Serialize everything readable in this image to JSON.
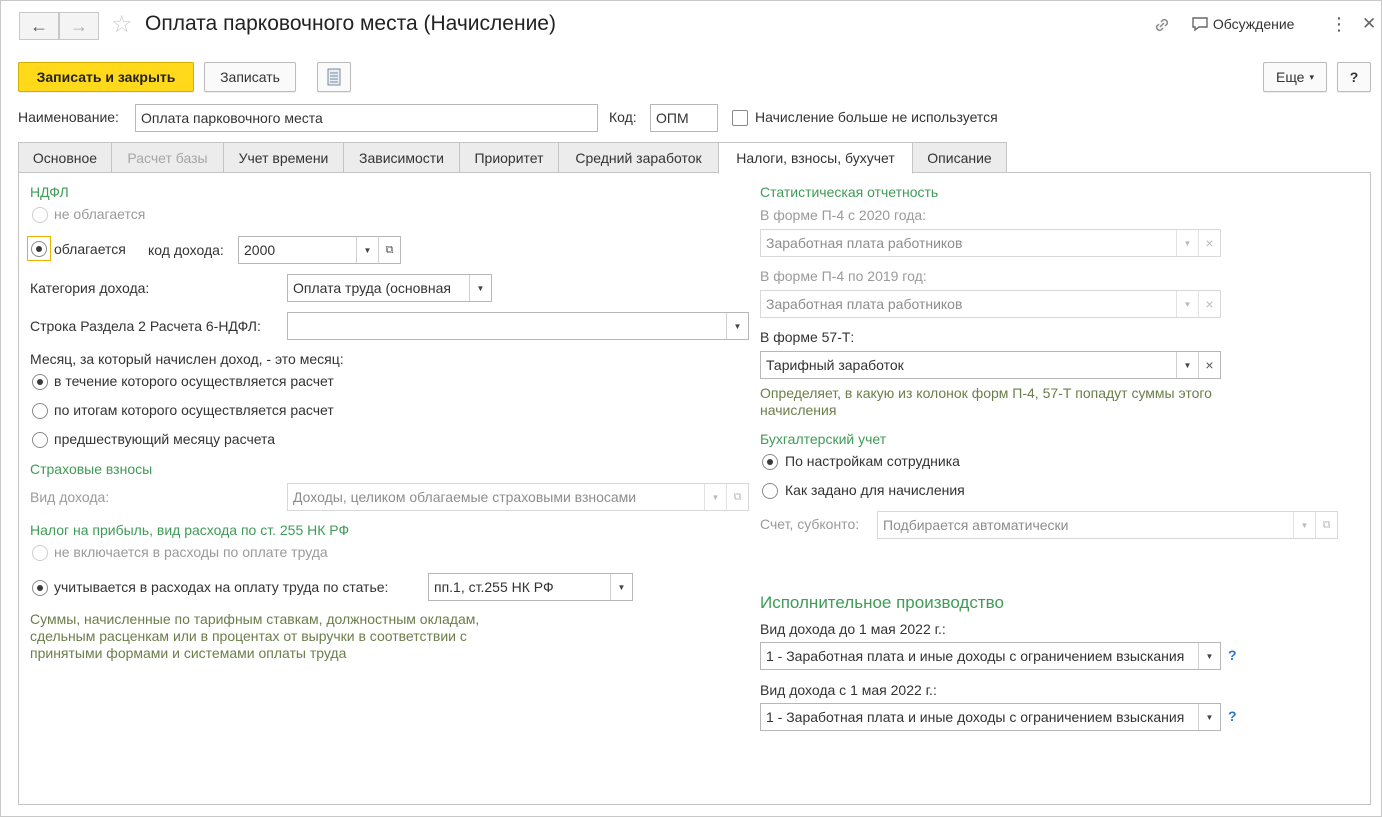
{
  "window": {
    "title": "Оплата парковочного места (Начисление)",
    "back_icon": "←",
    "forward_icon": "→",
    "star_icon": "☆",
    "link_icon": "🔗",
    "discussion_label": "Обсуждение",
    "more_icon": "⋮",
    "close_icon": "✕"
  },
  "toolbar": {
    "save_close": "Записать и закрыть",
    "save": "Записать",
    "more": "Еще",
    "more_arrow": "▾",
    "help": "?"
  },
  "form": {
    "name_label": "Наименование:",
    "name_value": "Оплата парковочного места",
    "code_label": "Код:",
    "code_value": "ОПМ",
    "unused_label": "Начисление больше не используется"
  },
  "tabs": [
    {
      "label": "Основное",
      "state": "normal"
    },
    {
      "label": "Расчет базы",
      "state": "disabled"
    },
    {
      "label": "Учет времени",
      "state": "normal"
    },
    {
      "label": "Зависимости",
      "state": "normal"
    },
    {
      "label": "Приоритет",
      "state": "normal"
    },
    {
      "label": "Средний заработок",
      "state": "normal"
    },
    {
      "label": "Налоги, взносы, бухучет",
      "state": "active"
    },
    {
      "label": "Описание",
      "state": "normal"
    }
  ],
  "ndfl": {
    "section": "НДФЛ",
    "not_taxed": "не облагается",
    "taxed": "облагается",
    "income_code_label": "код дохода:",
    "income_code_value": "2000",
    "category_label": "Категория дохода:",
    "category_value": "Оплата труда (основная",
    "row_label": "Строка Раздела 2 Расчета 6-НДФЛ:",
    "row_value": "",
    "month_label": "Месяц, за который начислен доход, - это месяц:",
    "month_opt1": "в течение которого осуществляется расчет",
    "month_opt2": "по итогам которого осуществляется расчет",
    "month_opt3": "предшествующий месяцу расчета"
  },
  "insurance": {
    "section": "Страховые взносы",
    "kind_label": "Вид дохода:",
    "kind_value": "Доходы, целиком облагаемые страховыми взносами"
  },
  "profit_tax": {
    "section": "Налог на прибыль, вид расхода по ст. 255 НК РФ",
    "opt_not_included": "не включается в расходы по оплате труда",
    "opt_included": "учитывается в расходах на оплату труда по статье:",
    "article_value": "пп.1, ст.255 НК РФ",
    "note": "Суммы, начисленные по тарифным ставкам, должностным окладам, сдельным расценкам или в процентах от выручки в соответствии с принятыми формами и системами оплаты труда"
  },
  "stats": {
    "section": "Статистическая отчетность",
    "p4_2020_label": "В форме П-4 с 2020 года:",
    "p4_2020_value": "Заработная плата работников",
    "p4_2019_label": "В форме П-4 по 2019 год:",
    "p4_2019_value": "Заработная плата работников",
    "f57_label": "В форме 57-Т:",
    "f57_value": "Тарифный заработок",
    "note": "Определяет, в какую из колонок форм П-4, 57-Т попадут суммы этого начисления"
  },
  "accounting": {
    "section": "Бухгалтерский учет",
    "opt_employee": "По настройкам сотрудника",
    "opt_accrual": "Как задано для начисления",
    "account_label": "Счет, субконто:",
    "account_value": "Подбирается автоматически"
  },
  "enforcement": {
    "section": "Исполнительное производство",
    "before_label": "Вид дохода до 1 мая 2022 г.:",
    "before_value": "1 - Заработная плата и иные доходы с ограничением взыскания",
    "after_label": "Вид дохода с 1 мая 2022 г.:",
    "after_value": "1 - Заработная плата и иные доходы с ограничением взыскания",
    "help": "?"
  },
  "glyphs": {
    "dropdown": "▼",
    "open": "⧉",
    "clear": "×"
  },
  "colors": {
    "primary_button": "#ffd91a",
    "section_green": "#3f9b57",
    "note_olive": "#6b7e4a",
    "help_blue": "#2b78c6"
  }
}
